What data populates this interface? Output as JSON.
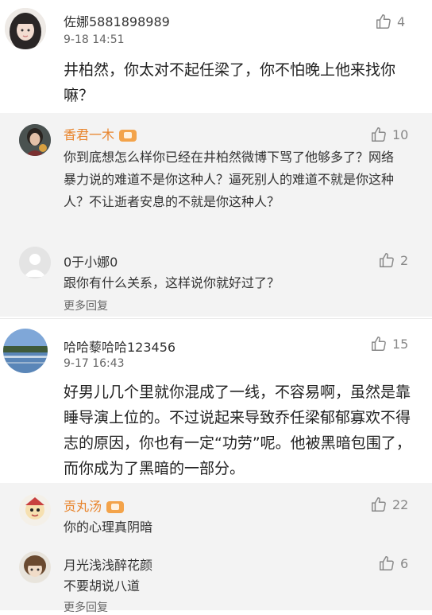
{
  "comments": [
    {
      "username": "佐娜5881898989",
      "time": "9-18 14:51",
      "likes": "4",
      "text": "井柏然，你太对不起任梁了，你不怕晚上他来找你嘛？",
      "replies": [
        {
          "username": "香君一木",
          "likes": "10",
          "text": "你到底想怎么样你已经在井柏然微博下骂了他够多了？网络暴力说的难道不是你这种人？逼死别人的难道不就是你这种人？不让逝者安息的不就是你这种人？"
        },
        {
          "username": "0于小娜0",
          "likes": "2",
          "text": "跟你有什么关系，这样说你就好过了？"
        }
      ],
      "more_replies": "更多回复"
    },
    {
      "username": "哈哈藜哈哈123456",
      "time": "9-17 16:43",
      "likes": "15",
      "text": "好男儿几个里就你混成了一线，不容易啊，虽然是靠睡导演上位的。不过说起来导致乔任梁郁郁寡欢不得志的原因，你也有一定“功劳”呢。他被黑暗包围了，而你成为了黑暗的一部分。",
      "replies": [
        {
          "username": "贡丸汤",
          "likes": "22",
          "text": "你的心理真阴暗"
        },
        {
          "username": "月光浅浅醉花颜",
          "likes": "6",
          "text": "不要胡说八道"
        }
      ],
      "more_replies": "更多回复"
    }
  ],
  "colors": {
    "accent_name": "#e8842c",
    "reply_bg": "#f3f3f3",
    "vip_badge": "#f3a34a"
  },
  "icons": {
    "like": "thumbs-up-icon",
    "vip": "vip-badge-icon"
  }
}
